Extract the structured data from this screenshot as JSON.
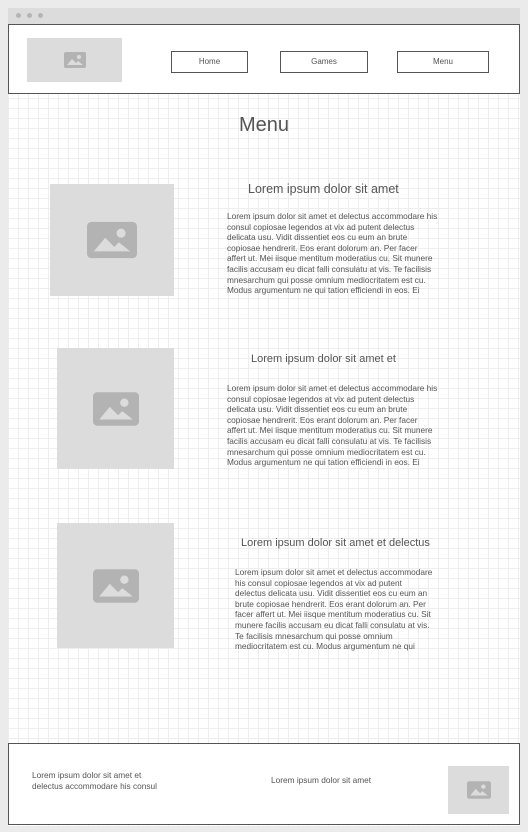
{
  "nav": {
    "logo_icon": "image-placeholder-icon",
    "items": [
      {
        "label": "Home"
      },
      {
        "label": "Games"
      },
      {
        "label": "Menu"
      }
    ]
  },
  "page": {
    "title": "Menu"
  },
  "items": [
    {
      "title": "Lorem ipsum dolor sit amet",
      "lines": [
        "Lorem ipsum dolor sit amet et delectus accommodare his",
        "consul copiosae legendos at vix ad putent delectus",
        "delicata usu. Vidit dissentiet eos cu eum an brute",
        "copiosae hendrerit. Eos erant dolorum an. Per facer",
        "affert ut. Mei iisque mentitum moderatius cu. Sit munere",
        "facilis accusam eu dicat falli consulatu at vis. Te facilisis",
        "mnesarchum qui posse omnium mediocritatem est cu.",
        "Modus argumentum ne qui tation efficiendi in eos. Ei"
      ]
    },
    {
      "title": "Lorem ipsum dolor sit amet et",
      "lines": [
        "Lorem ipsum dolor sit amet et delectus accommodare his",
        "consul copiosae legendos at vix ad putent delectus",
        "delicata usu. Vidit dissentiet eos cu eum an brute",
        "copiosae hendrerit. Eos erant dolorum an. Per facer",
        "affert ut. Mei iisque mentitum moderatius cu. Sit munere",
        "facilis accusam eu dicat falli consulatu at vis. Te facilisis",
        "mnesarchum qui posse omnium mediocritatem est cu.",
        "Modus argumentum ne qui tation efficiendi in eos. Ei"
      ]
    },
    {
      "title": "Lorem ipsum dolor sit amet et delectus",
      "lines": [
        "Lorem ipsum dolor sit amet et delectus accommodare",
        "his consul copiosae legendos at vix ad putent",
        "delectus delicata usu. Vidit dissentiet eos cu eum an",
        "brute copiosae hendrerit. Eos erant dolorum an. Per",
        "facer affert ut. Mei iisque mentitum moderatius cu. Sit",
        "munere facilis accusam eu dicat falli consulatu at vis.",
        "Te facilisis mnesarchum qui posse omnium",
        "mediocritatem est cu. Modus argumentum ne qui"
      ]
    }
  ],
  "footer": {
    "left_lines": [
      "Lorem ipsum dolor sit amet et",
      "delectus accommodare his consul"
    ],
    "center": "Lorem ipsum dolor sit amet",
    "image_icon": "image-placeholder-icon"
  },
  "colors": {
    "placeholder": "#dcdcdc",
    "placeholder_icon": "#b3b3b3",
    "border": "#555555"
  }
}
